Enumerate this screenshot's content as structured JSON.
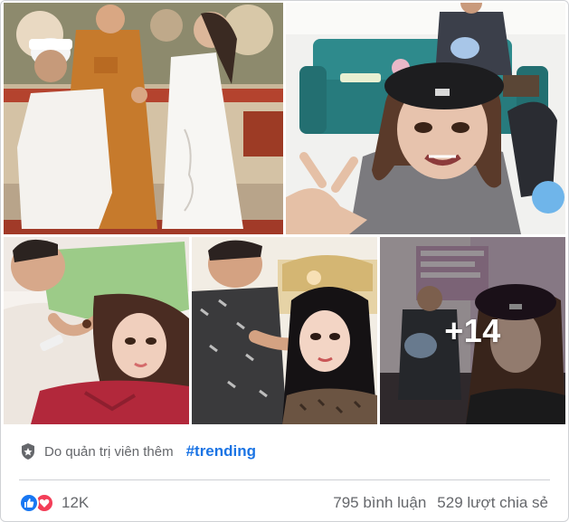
{
  "gallery": {
    "photos": [
      {
        "icon": "wedding-photo"
      },
      {
        "icon": "selfie-sofa-photo"
      },
      {
        "icon": "couple-bed-photo"
      },
      {
        "icon": "couple-earring-photo"
      },
      {
        "icon": "selfie-baby-photo"
      }
    ],
    "more_count": "+14"
  },
  "post": {
    "admin_label": "Do quản trị viên thêm",
    "hashtag": "#trending"
  },
  "footer": {
    "reaction_count": "12K",
    "comments": "795 bình luận",
    "shares": "529 lượt chia sẻ"
  },
  "colors": {
    "accent": "#1b74e4",
    "like": "#1877f2",
    "love": "#f33e58",
    "muted": "#65676b"
  }
}
